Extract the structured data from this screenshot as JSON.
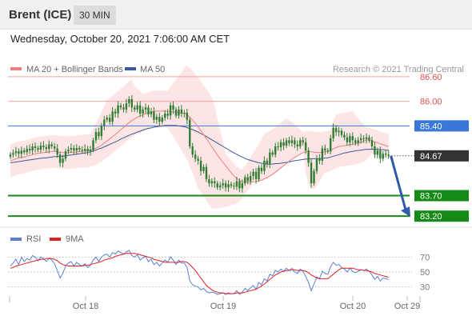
{
  "header": {
    "instrument": "Brent (ICE)",
    "timeframe": "30 MIN",
    "datetime": "Wednesday, October 20, 2021 7:06:00 AM CET"
  },
  "legend": {
    "ma20_label": "MA 20 + Bollinger Bands",
    "ma50_label": "MA 50",
    "credit": "Research © 2021 Trading Central"
  },
  "colors": {
    "ma20": "#f08080",
    "ma50": "#3c5a9a",
    "bands_fill": "#fde0e0",
    "candle": "#2e7d32",
    "resistance": "#f5a0a0",
    "pivot": "#3a78d8",
    "support": "#168a16",
    "last_price": "#333333",
    "arrow": "#2e5aa8",
    "rsi": "#5b7fd6",
    "rsi_ma": "#e02020"
  },
  "chart_data": [
    {
      "type": "candlestick",
      "title": "Brent (ICE)",
      "timeframe": "30 MIN",
      "ylim": [
        82.95,
        86.85
      ],
      "x_ticks": [
        "Oct 18",
        "Oct 19",
        "Oct 20",
        "Oct 29"
      ],
      "levels": [
        {
          "value": 86.6,
          "label": "86.60",
          "role": "resistance"
        },
        {
          "value": 86.0,
          "label": "86.00",
          "role": "resistance"
        },
        {
          "value": 85.4,
          "label": "85.40",
          "role": "pivot"
        },
        {
          "value": 84.67,
          "label": "84.67",
          "role": "last"
        },
        {
          "value": 83.7,
          "label": "83.70",
          "role": "support"
        },
        {
          "value": 83.2,
          "label": "83.20",
          "role": "support"
        }
      ],
      "close": [
        84.7,
        84.74,
        84.78,
        84.72,
        84.8,
        84.76,
        84.84,
        84.8,
        84.9,
        84.86,
        84.82,
        84.92,
        84.88,
        84.84,
        84.95,
        84.9,
        84.85,
        84.7,
        84.5,
        84.6,
        84.78,
        84.82,
        84.86,
        84.8,
        84.86,
        84.82,
        84.8,
        84.84,
        84.78,
        84.82,
        85.05,
        85.25,
        85.15,
        85.4,
        85.55,
        85.6,
        85.5,
        85.75,
        85.7,
        85.9,
        85.85,
        85.8,
        85.95,
        86.05,
        85.85,
        85.8,
        85.9,
        85.7,
        85.8,
        85.85,
        85.68,
        85.75,
        85.55,
        85.62,
        85.5,
        85.6,
        85.7,
        85.65,
        85.9,
        85.8,
        85.65,
        85.8,
        85.7,
        85.72,
        85.55,
        84.9,
        84.7,
        84.6,
        84.55,
        84.3,
        84.4,
        84.1,
        84.0,
        84.05,
        84.0,
        83.9,
        83.95,
        84.0,
        83.9,
        83.98,
        83.94,
        83.92,
        84.05,
        83.88,
        84.0,
        84.15,
        84.05,
        84.18,
        84.28,
        84.1,
        84.38,
        84.3,
        84.55,
        84.48,
        84.75,
        84.7,
        84.9,
        84.88,
        85.0,
        84.92,
        85.05,
        84.98,
        85.05,
        84.95,
        84.9,
        85.05,
        85.0,
        84.8,
        84.5,
        84.0,
        84.3,
        84.6,
        84.55,
        84.85,
        84.8,
        84.78,
        85.1,
        85.35,
        85.25,
        85.28,
        85.18,
        85.12,
        85.0,
        85.15,
        85.05,
        84.98,
        85.05,
        85.1,
        85.08,
        85.12,
        85.05,
        84.9,
        84.7,
        84.8,
        84.6,
        84.72,
        84.7,
        84.68
      ],
      "ma20": [
        84.55,
        84.57,
        84.6,
        84.62,
        84.63,
        84.64,
        84.66,
        84.68,
        84.7,
        84.72,
        84.73,
        84.74,
        84.75,
        84.76,
        84.77,
        84.78,
        84.78,
        84.77,
        84.76,
        84.75,
        84.75,
        84.75,
        84.76,
        84.76,
        84.77,
        84.78,
        84.78,
        84.79,
        84.79,
        84.8,
        84.82,
        84.86,
        84.89,
        84.93,
        84.98,
        85.03,
        85.08,
        85.14,
        85.19,
        85.25,
        85.31,
        85.36,
        85.42,
        85.48,
        85.53,
        85.57,
        85.61,
        85.64,
        85.67,
        85.7,
        85.72,
        85.74,
        85.75,
        85.76,
        85.76,
        85.76,
        85.76,
        85.75,
        85.75,
        85.74,
        85.73,
        85.72,
        85.71,
        85.71,
        85.68,
        85.61,
        85.54,
        85.46,
        85.38,
        85.28,
        85.19,
        85.09,
        84.99,
        84.88,
        84.79,
        84.69,
        84.6,
        84.51,
        84.43,
        84.34,
        84.26,
        84.18,
        84.12,
        84.07,
        84.04,
        84.03,
        84.02,
        84.03,
        84.04,
        84.04,
        84.06,
        84.08,
        84.11,
        84.14,
        84.18,
        84.22,
        84.27,
        84.32,
        84.38,
        84.43,
        84.48,
        84.54,
        84.59,
        84.63,
        84.67,
        84.71,
        84.75,
        84.77,
        84.78,
        84.77,
        84.76,
        84.75,
        84.75,
        84.76,
        84.77,
        84.77,
        84.8,
        84.84,
        84.87,
        84.9,
        84.91,
        84.92,
        84.93,
        84.94,
        84.95,
        84.96,
        84.98,
        85.0,
        85.03,
        85.06,
        85.05,
        85.03,
        85.01,
        84.99,
        84.96,
        84.94,
        84.92,
        84.9
      ],
      "bollinger": {
        "upper": [
          84.95,
          84.97,
          85.0,
          85.02,
          85.03,
          85.04,
          85.06,
          85.08,
          85.1,
          85.12,
          85.13,
          85.14,
          85.15,
          85.16,
          85.17,
          85.18,
          85.18,
          85.17,
          85.16,
          85.15,
          85.15,
          85.15,
          85.16,
          85.16,
          85.17,
          85.18,
          85.18,
          85.19,
          85.19,
          85.2,
          85.32,
          85.46,
          85.59,
          85.73,
          85.88,
          86.03,
          86.08,
          86.14,
          86.19,
          86.25,
          86.31,
          86.36,
          86.42,
          86.48,
          86.53,
          86.37,
          86.31,
          86.24,
          86.17,
          86.2,
          86.22,
          86.24,
          86.25,
          86.26,
          86.26,
          86.26,
          86.26,
          86.25,
          86.35,
          86.44,
          86.53,
          86.62,
          86.71,
          86.81,
          86.88,
          86.81,
          86.74,
          86.66,
          86.58,
          86.48,
          86.39,
          86.29,
          86.19,
          86.08,
          85.89,
          85.59,
          85.3,
          85.01,
          84.73,
          84.64,
          84.56,
          84.48,
          84.42,
          84.37,
          84.34,
          84.43,
          84.52,
          84.63,
          84.74,
          84.84,
          84.96,
          85.08,
          85.21,
          85.24,
          85.28,
          85.32,
          85.37,
          85.42,
          85.48,
          85.53,
          85.58,
          85.54,
          85.49,
          85.43,
          85.37,
          85.31,
          85.25,
          85.27,
          85.28,
          85.27,
          85.26,
          85.25,
          85.25,
          85.26,
          85.27,
          85.27,
          85.3,
          85.54,
          85.67,
          85.7,
          85.71,
          85.72,
          85.73,
          85.74,
          85.75,
          85.66,
          85.58,
          85.5,
          85.43,
          85.36,
          85.35,
          85.33,
          85.31,
          85.29,
          85.26,
          85.24,
          85.22,
          85.2
        ],
        "lower": [
          84.15,
          84.17,
          84.2,
          84.22,
          84.23,
          84.24,
          84.26,
          84.28,
          84.3,
          84.32,
          84.33,
          84.34,
          84.35,
          84.36,
          84.37,
          84.38,
          84.38,
          84.37,
          84.36,
          84.35,
          84.35,
          84.35,
          84.36,
          84.36,
          84.37,
          84.38,
          84.38,
          84.39,
          84.39,
          84.4,
          84.42,
          84.46,
          84.49,
          84.53,
          84.58,
          84.63,
          84.68,
          84.74,
          84.79,
          84.85,
          84.91,
          84.96,
          85.02,
          85.08,
          85.13,
          85.17,
          85.21,
          85.24,
          85.27,
          85.3,
          85.32,
          85.34,
          85.35,
          85.36,
          85.36,
          85.36,
          85.36,
          85.35,
          85.25,
          85.14,
          85.03,
          84.92,
          84.81,
          84.71,
          84.58,
          84.41,
          84.24,
          84.06,
          83.88,
          83.78,
          83.69,
          83.59,
          83.49,
          83.38,
          83.39,
          83.39,
          83.4,
          83.41,
          83.43,
          83.44,
          83.46,
          83.48,
          83.52,
          83.57,
          83.64,
          83.73,
          83.82,
          83.93,
          84.04,
          84.04,
          84.06,
          84.08,
          84.11,
          84.14,
          84.18,
          84.22,
          84.27,
          84.32,
          84.38,
          84.43,
          84.48,
          84.54,
          84.59,
          84.63,
          84.67,
          84.71,
          84.75,
          84.27,
          83.98,
          83.87,
          83.86,
          83.95,
          84.05,
          84.16,
          84.27,
          84.27,
          84.3,
          84.34,
          84.37,
          84.4,
          84.41,
          84.42,
          84.43,
          84.44,
          84.45,
          84.46,
          84.48,
          84.5,
          84.53,
          84.56,
          84.65,
          84.73,
          84.71,
          84.69,
          84.66,
          84.64,
          84.62,
          84.6
        ]
      },
      "ma50": [
        84.5,
        84.51,
        84.52,
        84.53,
        84.54,
        84.55,
        84.56,
        84.57,
        84.58,
        84.59,
        84.6,
        84.61,
        84.62,
        84.62,
        84.63,
        84.64,
        84.65,
        84.65,
        84.66,
        84.66,
        84.67,
        84.68,
        84.69,
        84.7,
        84.71,
        84.72,
        84.73,
        84.74,
        84.75,
        84.77,
        84.79,
        84.81,
        84.84,
        84.86,
        84.89,
        84.92,
        84.95,
        84.98,
        85.01,
        85.04,
        85.08,
        85.11,
        85.14,
        85.17,
        85.2,
        85.22,
        85.25,
        85.27,
        85.3,
        85.32,
        85.34,
        85.35,
        85.37,
        85.38,
        85.39,
        85.4,
        85.41,
        85.41,
        85.41,
        85.41,
        85.41,
        85.4,
        85.39,
        85.38,
        85.36,
        85.33,
        85.31,
        85.28,
        85.25,
        85.21,
        85.18,
        85.14,
        85.1,
        85.06,
        85.02,
        84.98,
        84.94,
        84.9,
        84.86,
        84.82,
        84.78,
        84.74,
        84.71,
        84.67,
        84.64,
        84.61,
        84.58,
        84.56,
        84.54,
        84.52,
        84.5,
        84.49,
        84.48,
        84.47,
        84.47,
        84.47,
        84.48,
        84.48,
        84.49,
        84.5,
        84.51,
        84.52,
        84.54,
        84.55,
        84.56,
        84.57,
        84.58,
        84.59,
        84.6,
        84.6,
        84.6,
        84.6,
        84.6,
        84.61,
        84.62,
        84.62,
        84.64,
        84.66,
        84.68,
        84.7,
        84.72,
        84.74,
        84.75,
        84.77,
        84.78,
        84.79,
        84.8,
        84.81,
        84.82,
        84.83,
        84.83,
        84.83,
        84.83,
        84.83,
        84.82,
        84.82,
        84.81,
        84.81
      ],
      "forecast": {
        "from": 84.67,
        "to": 83.2
      }
    },
    {
      "type": "line",
      "title": "RSI",
      "yticks": [
        30,
        50,
        70
      ],
      "series": [
        {
          "name": "RSI",
          "values": [
            58,
            62,
            67,
            60,
            70,
            64,
            68,
            66,
            72,
            70,
            65,
            70,
            68,
            64,
            69,
            66,
            61,
            52,
            42,
            48,
            58,
            62,
            64,
            58,
            63,
            60,
            58,
            61,
            56,
            59,
            66,
            70,
            64,
            70,
            73,
            74,
            70,
            76,
            74,
            78,
            76,
            74,
            77,
            79,
            72,
            70,
            73,
            66,
            69,
            71,
            64,
            67,
            60,
            63,
            58,
            62,
            66,
            63,
            70,
            66,
            60,
            66,
            62,
            62,
            56,
            38,
            33,
            31,
            30,
            26,
            28,
            24,
            22,
            23,
            22,
            20,
            21,
            22,
            20,
            22,
            21,
            21,
            25,
            20,
            23,
            28,
            25,
            29,
            32,
            27,
            36,
            33,
            41,
            38,
            47,
            45,
            52,
            50,
            54,
            51,
            55,
            52,
            55,
            50,
            48,
            54,
            51,
            44,
            36,
            25,
            34,
            43,
            41,
            51,
            48,
            47,
            57,
            63,
            59,
            60,
            56,
            54,
            50,
            55,
            51,
            49,
            51,
            53,
            52,
            54,
            51,
            46,
            40,
            44,
            38,
            42,
            41,
            40
          ]
        },
        {
          "name": "9MA",
          "values": [
            55,
            56,
            58,
            59,
            60,
            61,
            62,
            63,
            64,
            65,
            66,
            67,
            67,
            68,
            68,
            68,
            67,
            65,
            62,
            60,
            59,
            58,
            58,
            58,
            58,
            58,
            58,
            59,
            59,
            60,
            61,
            62,
            63,
            64,
            66,
            67,
            68,
            69,
            71,
            72,
            73,
            74,
            75,
            75,
            75,
            75,
            74,
            73,
            72,
            71,
            70,
            69,
            67,
            66,
            65,
            64,
            63,
            63,
            63,
            63,
            63,
            63,
            64,
            64,
            63,
            60,
            56,
            52,
            47,
            42,
            37,
            32,
            29,
            26,
            24,
            23,
            22,
            22,
            21,
            21,
            21,
            21,
            22,
            22,
            22,
            23,
            24,
            25,
            26,
            27,
            29,
            31,
            34,
            37,
            40,
            43,
            46,
            48,
            50,
            51,
            52,
            52,
            53,
            53,
            52,
            52,
            52,
            51,
            49,
            46,
            44,
            42,
            41,
            41,
            41,
            41,
            44,
            47,
            50,
            53,
            55,
            55,
            55,
            55,
            55,
            54,
            53,
            53,
            52,
            52,
            51,
            50,
            48,
            47,
            46,
            45,
            44,
            43
          ]
        }
      ]
    }
  ]
}
